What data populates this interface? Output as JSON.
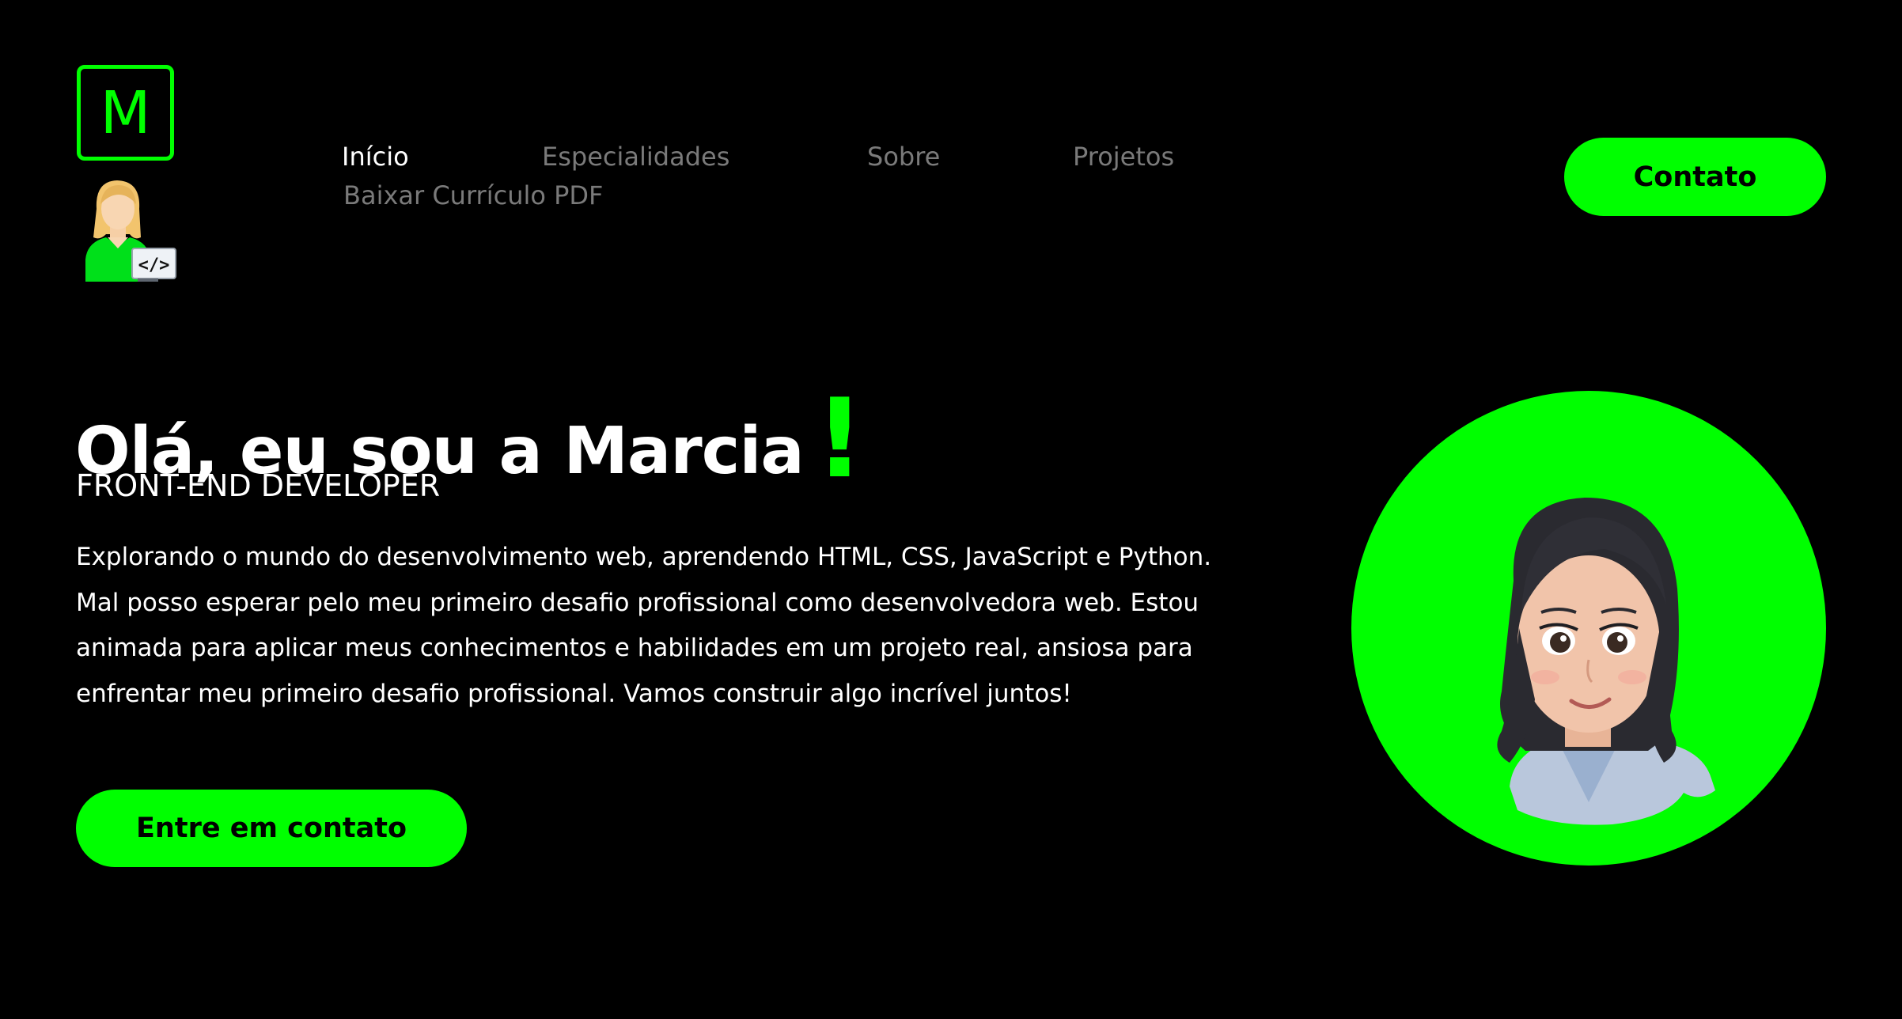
{
  "header": {
    "logo_letter": "M",
    "nav": [
      {
        "label": "Início",
        "active": true
      },
      {
        "label": "Especialidades",
        "active": false
      },
      {
        "label": "Sobre",
        "active": false
      },
      {
        "label": "Projetos",
        "active": false
      },
      {
        "label": "Baixar Currículo PDF",
        "active": false
      }
    ],
    "contact_button": "Contato"
  },
  "hero": {
    "title": "Olá, eu sou a Marcia",
    "exclamation": "!",
    "role": "FRONT-END DEVELOPER",
    "description": "Explorando o mundo do desenvolvimento web, aprendendo HTML, CSS, JavaScript e Python. Mal posso esperar pelo meu primeiro desafio profissional como desenvolvedora web. Estou animada para aplicar meus conhecimentos e habilidades em um projeto real, ansiosa para enfrentar meu primeiro desafio profissional. Vamos construir algo incrível juntos!",
    "cta_button": "Entre em contato"
  },
  "avatar_badge_text": "</>",
  "icons": {
    "logo": "m-logo-icon",
    "developer_avatar": "developer-avatar-icon",
    "portrait": "profile-portrait"
  },
  "colors": {
    "background": "#000000",
    "accent": "#00ff00",
    "text": "#ffffff",
    "nav_inactive": "#7a7a7a"
  }
}
